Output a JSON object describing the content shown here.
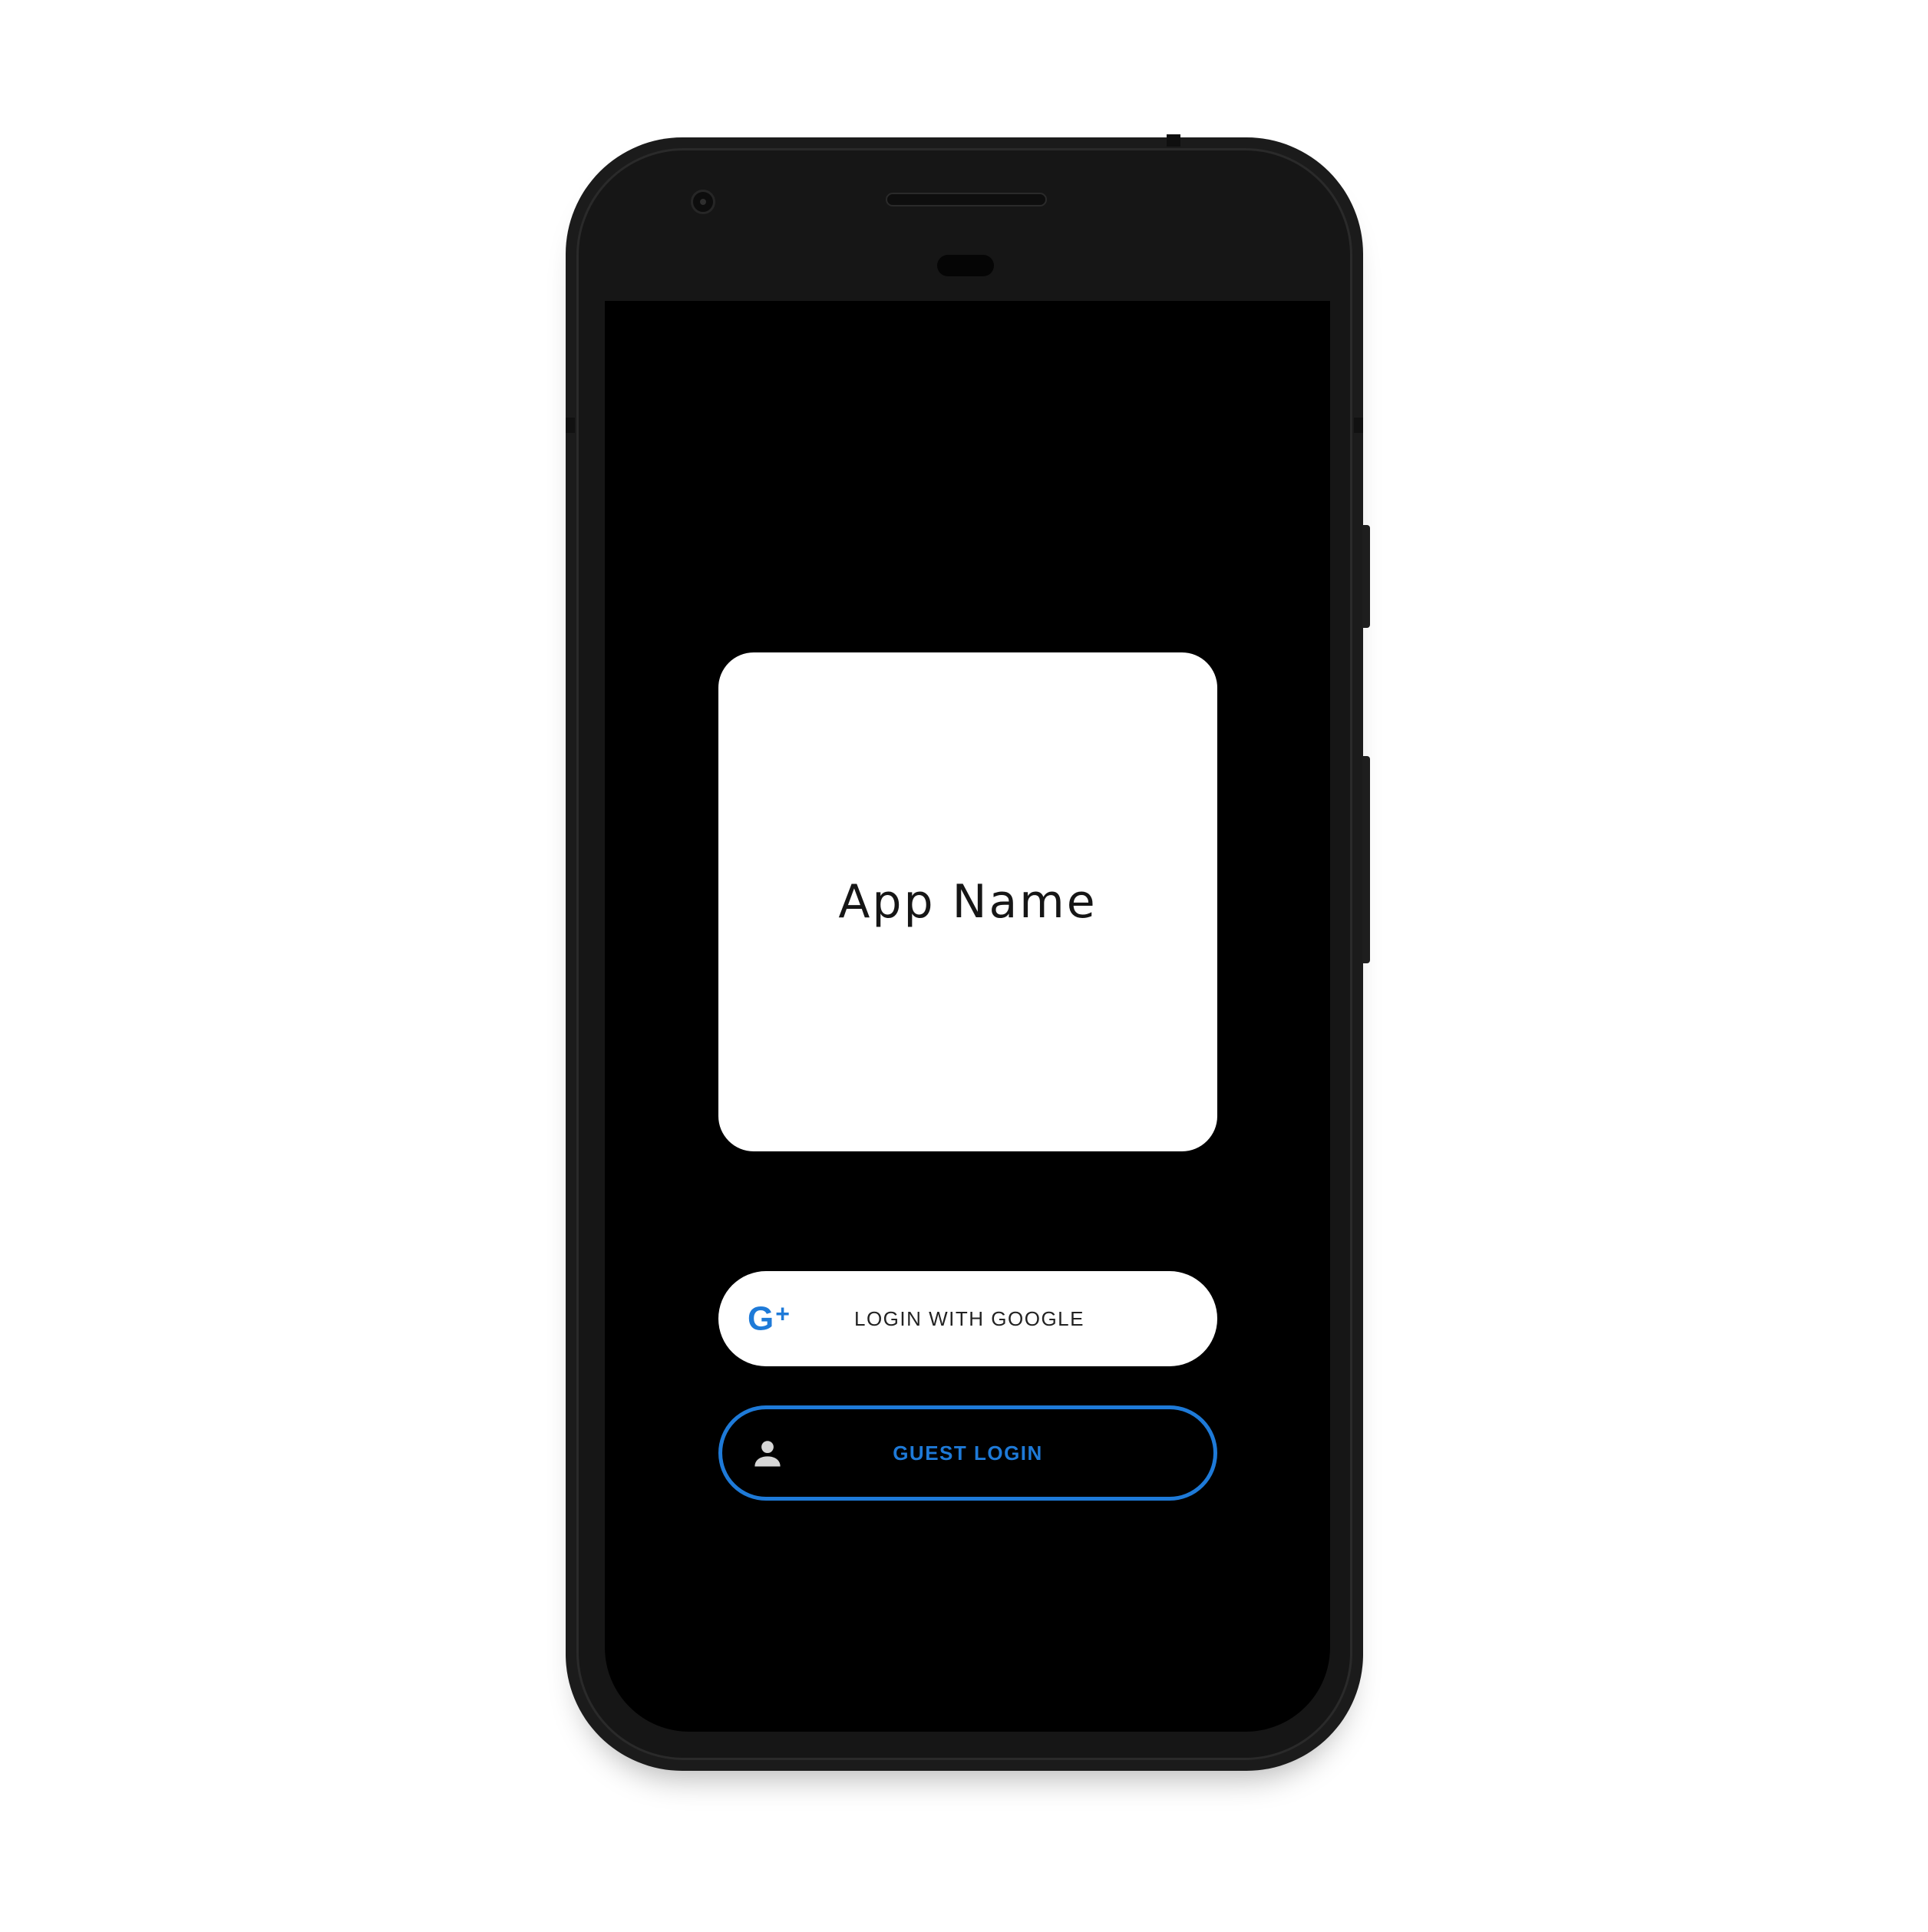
{
  "app": {
    "name": "App Name"
  },
  "buttons": {
    "google": {
      "label": "LOGIN WITH GOOGLE",
      "icon": "google-plus-icon",
      "icon_text": "G",
      "icon_plus": "+"
    },
    "guest": {
      "label": "GUEST LOGIN",
      "icon": "person-icon"
    }
  },
  "colors": {
    "screen_background": "#000000",
    "card_background": "#ffffff",
    "accent": "#1e7ad8",
    "google_label": "#222222",
    "person_icon": "#d6d6d6",
    "phone_body": "#1b1b1b"
  }
}
